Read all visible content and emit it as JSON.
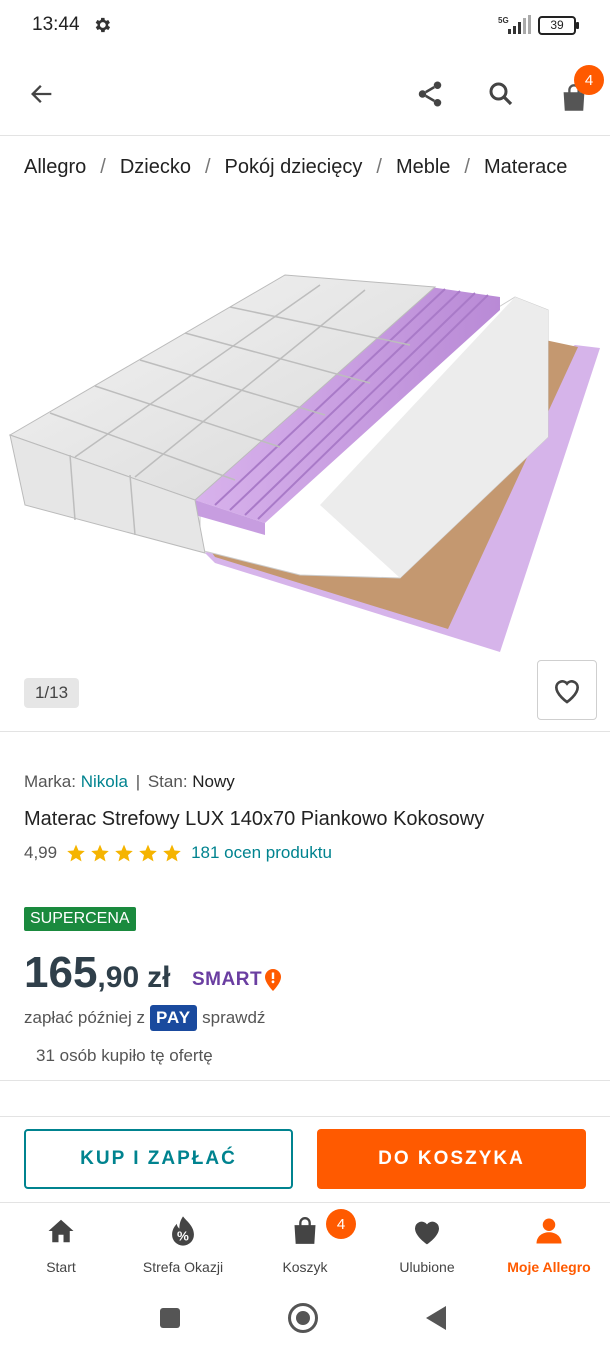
{
  "status_bar": {
    "time": "13:44",
    "network": "5G",
    "battery": "39",
    "icons": [
      "gear-icon",
      "signal-icon",
      "battery-icon"
    ]
  },
  "toolbar": {
    "back_icon": "arrow-left-icon",
    "share_icon": "share-icon",
    "search_icon": "search-icon",
    "cart_icon": "shopping-bag-icon",
    "cart_count": "4"
  },
  "breadcrumb": [
    "Allegro",
    "Dziecko",
    "Pokój dziecięcy",
    "Meble",
    "Materace"
  ],
  "gallery": {
    "counter": "1/13",
    "favorite_icon": "heart-outline-icon"
  },
  "product": {
    "brand_label": "Marka:",
    "brand": "Nikola",
    "separator": "|",
    "condition_label": "Stan:",
    "condition": "Nowy",
    "title": "Materac Strefowy LUX 140x70 Piankowo Kokosowy",
    "rating": "4,99",
    "rating_stars": 5,
    "rating_count": "181 ocen produktu",
    "badge": "SUPERCENA",
    "price_integer": "165",
    "price_decimal": ",90",
    "currency": "zł",
    "smart_label": "SMART",
    "pay_later_prefix": "zapłać później z",
    "pay_logo": "PAY",
    "pay_later_link": "sprawdź",
    "bought": "31 osób kupiło tę ofertę"
  },
  "actions": {
    "buy_now": "KUP I ZAPŁAĆ",
    "add_to_cart": "DO KOSZYKA"
  },
  "bottom_nav": [
    {
      "label": "Start",
      "icon": "home-icon"
    },
    {
      "label": "Strefa Okazji",
      "icon": "percent-tag-icon"
    },
    {
      "label": "Koszyk",
      "icon": "shopping-bag-icon",
      "badge": "4"
    },
    {
      "label": "Ulubione",
      "icon": "heart-icon"
    },
    {
      "label": "Moje Allegro",
      "icon": "person-icon",
      "active": true
    }
  ],
  "colors": {
    "accent_orange": "#ff5a00",
    "teal_link": "#00838f",
    "supercena_green": "#1a8a3e",
    "smart_purple": "#6a3ea1",
    "pay_blue": "#1a4a9e"
  }
}
